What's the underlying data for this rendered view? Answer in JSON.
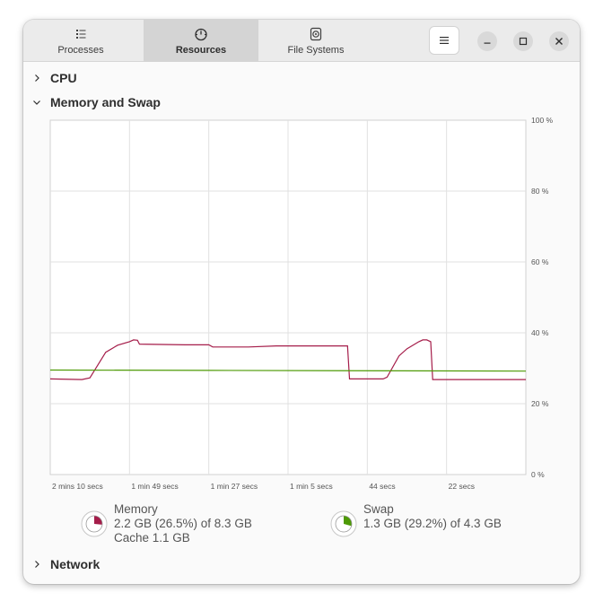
{
  "tabs": [
    {
      "label": "Processes",
      "icon": "list-icon"
    },
    {
      "label": "Resources",
      "icon": "gauge-icon"
    },
    {
      "label": "File Systems",
      "icon": "disk-icon"
    }
  ],
  "active_tab": "Resources",
  "sections": {
    "cpu": "CPU",
    "memory": "Memory and Swap",
    "network": "Network"
  },
  "chart_data": {
    "type": "line",
    "x_tick_labels": [
      "2 mins 10 secs",
      "1 min 49 secs",
      "1 min 27 secs",
      "1 min 5 secs",
      "44 secs",
      "22 secs"
    ],
    "y_tick_labels": [
      "100 %",
      "80 %",
      "60 %",
      "40 %",
      "20 %",
      "0 %"
    ],
    "ylim": [
      0,
      100
    ],
    "xlim": [
      0,
      120
    ],
    "grid": true,
    "series": [
      {
        "name": "Memory",
        "color": "#a51d4a",
        "points": [
          [
            0,
            27.0
          ],
          [
            8,
            26.8
          ],
          [
            10,
            27.3
          ],
          [
            14,
            34.5
          ],
          [
            17,
            36.5
          ],
          [
            20,
            37.5
          ],
          [
            21,
            38.0
          ],
          [
            22,
            37.9
          ],
          [
            22.5,
            36.8
          ],
          [
            34,
            36.6
          ],
          [
            40,
            36.6
          ],
          [
            41,
            36.0
          ],
          [
            50,
            36.0
          ],
          [
            57,
            36.3
          ],
          [
            75,
            36.3
          ],
          [
            75.5,
            27.0
          ],
          [
            84,
            27.0
          ],
          [
            85,
            27.5
          ],
          [
            88,
            33.5
          ],
          [
            90,
            35.5
          ],
          [
            93,
            37.5
          ],
          [
            94,
            38.0
          ],
          [
            95,
            38.0
          ],
          [
            96,
            37.5
          ],
          [
            96.5,
            26.8
          ],
          [
            120,
            26.8
          ]
        ]
      },
      {
        "name": "Swap",
        "color": "#4e9a06",
        "points": [
          [
            0,
            29.5
          ],
          [
            40,
            29.4
          ],
          [
            120,
            29.2
          ]
        ]
      }
    ]
  },
  "memory": {
    "title": "Memory",
    "usage": "2.2 GB (26.5%) of 8.3 GB",
    "cache": "Cache 1.1 GB",
    "percent": 26.5,
    "color": "#a51d4a"
  },
  "swap": {
    "title": "Swap",
    "usage": "1.3 GB (29.2%) of 4.3 GB",
    "percent": 29.2,
    "color": "#4e9a06"
  }
}
